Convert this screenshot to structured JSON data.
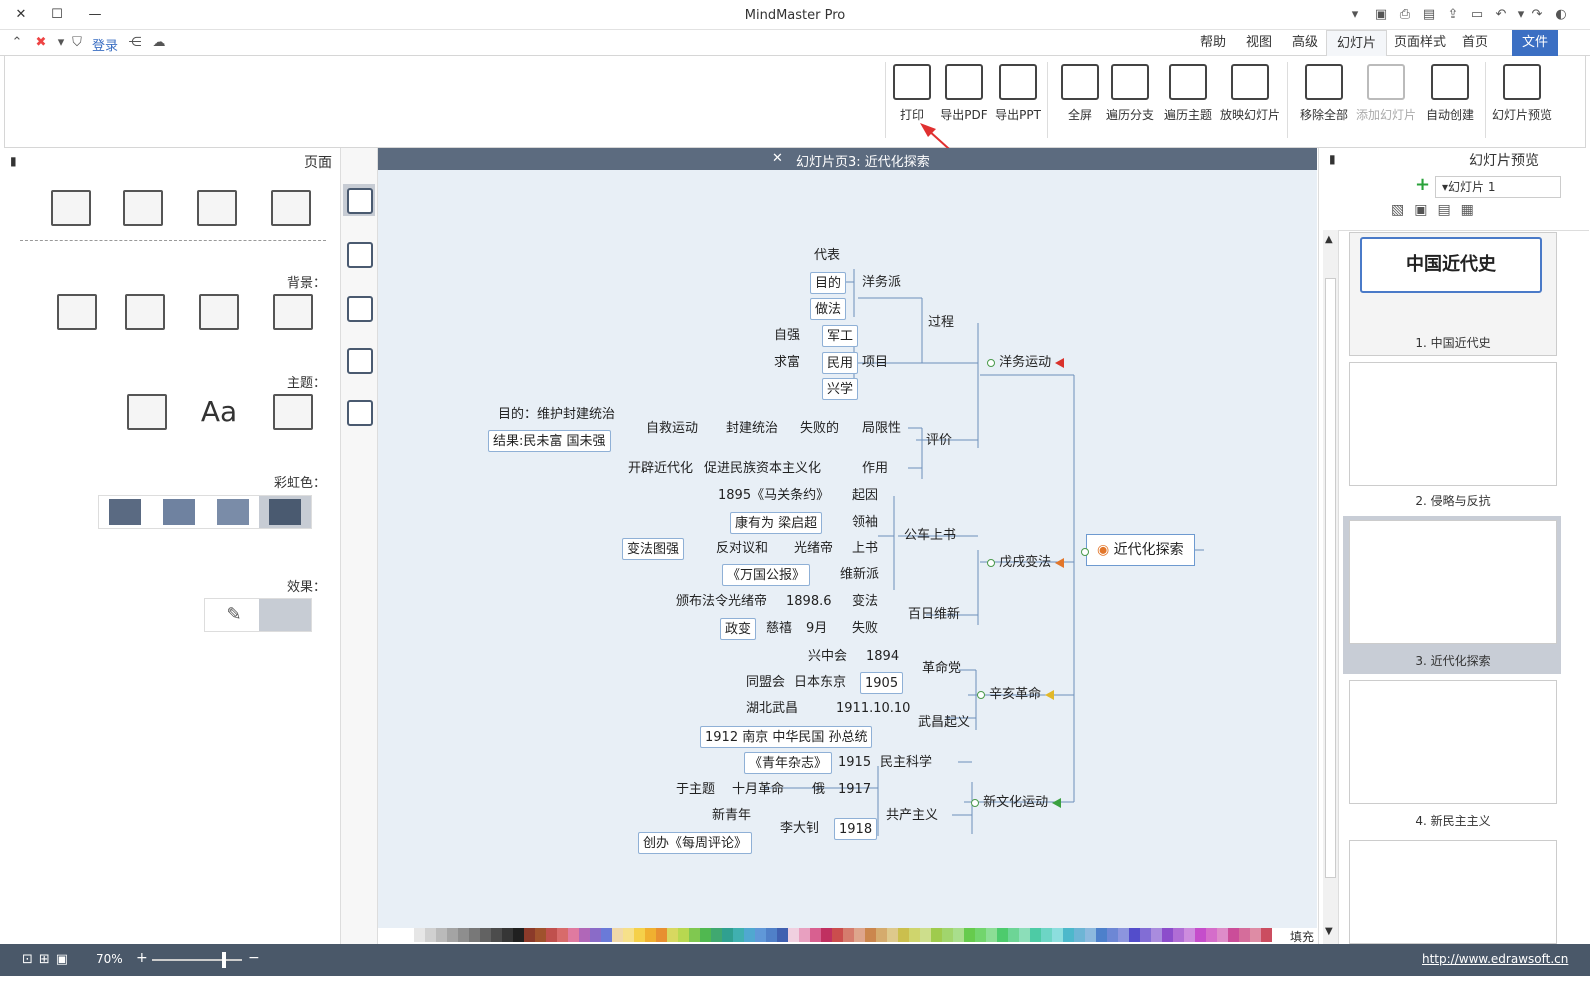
{
  "window": {
    "title": "MindMaster Pro"
  },
  "menu": {
    "file": "文件",
    "items": [
      "首页",
      "页面样式",
      "幻灯片",
      "高级",
      "视图",
      "帮助"
    ],
    "login": "登录"
  },
  "ribbon": {
    "buttons": [
      {
        "label": "幻灯片预览",
        "disabled": false
      },
      {
        "label": "自动创建",
        "disabled": false
      },
      {
        "label": "添加幻灯片",
        "disabled": true
      },
      {
        "label": "移除全部",
        "disabled": false
      },
      {
        "label": "放映幻灯片",
        "disabled": false
      },
      {
        "label": "遍历主题",
        "disabled": false
      },
      {
        "label": "遍历分支",
        "disabled": false
      },
      {
        "label": "全屏",
        "disabled": false
      },
      {
        "label": "导出PPT",
        "disabled": false
      },
      {
        "label": "导出PDF",
        "disabled": false
      },
      {
        "label": "打印",
        "disabled": false
      }
    ]
  },
  "left_pane": {
    "title": "页面",
    "sections": {
      "background": "背景：",
      "theme": "主题：",
      "rainbow": "彩虹色：",
      "effect": "效果："
    }
  },
  "canvas": {
    "header": "幻灯片页3: 近代化探索",
    "palette_label": "填充",
    "root": "近代化探索",
    "branches": [
      {
        "label": "洋务运动",
        "flag": "#d9312b"
      },
      {
        "label": "戊戌变法",
        "flag": "#e2762a"
      },
      {
        "label": "辛亥革命",
        "flag": "#e2b82a"
      },
      {
        "label": "新文化运动",
        "flag": "#3aa040"
      }
    ],
    "nodes": {
      "guocheng": "过程",
      "yangwupai": "洋务派",
      "daibiao": "代表",
      "mudi": "目的",
      "zuofa": "做法",
      "xiangmu": "项目",
      "jungong": "军工",
      "ziqiang": "自强",
      "minyong": "民用",
      "qiufu": "求富",
      "xingxue": "兴学",
      "pingjia": "评价",
      "juxianxing": "局限性",
      "shibaide": "失败的",
      "fengjian": "封建统治",
      "zijiu": "自救运动",
      "mudi2": "目的：维护封建统治",
      "jieguo": "结果:民未富 国未强",
      "zuoyong": "作用",
      "cujin": "促进民族资本主义化",
      "kaiqi": "开辟近代化",
      "gongche": "公车上书",
      "qiyin": "起因",
      "maguan": "1895《马关条约》",
      "lingxiu": "领袖",
      "kangliang": "康有为 梁启超",
      "shangshu": "上书",
      "guangxu": "光绪帝",
      "fandui": "反对议和",
      "bianfa": "变法图强",
      "weixinpai": "维新派",
      "wanguo": "《万国公报》",
      "bairi": "百日维新",
      "bianfa2": "变法",
      "date1898": "1898.6",
      "guangxu2": "光绪帝",
      "banbu": "颁布法令",
      "shibai": "失败",
      "jiuyue": "9月",
      "cixi": "慈禧",
      "zhengbian": "政变",
      "gemingdang": "革命党",
      "y1894": "1894",
      "xingzhonghui": "兴中会",
      "y1905": "1905",
      "tokyo": "日本东京",
      "tongmenghui": "同盟会",
      "wuchang": "武昌起义",
      "d19111010": "1911.10.10",
      "hubei": "湖北武昌",
      "y1912": "1912 南京 中华民国 孙总统",
      "minzhu": "民主科学",
      "y1915": "1915",
      "qingnian": "《青年杂志》",
      "gongchan": "共产主义",
      "y1917": "1917",
      "e": "俄",
      "shiyue": "十月革命",
      "yu": "于主题",
      "y1918": "1918",
      "lidazhao": "李大钊",
      "xinqingnian": "新青年",
      "chuangban": "创办《每周评论》"
    }
  },
  "right_pane": {
    "title": "幻灯片预览",
    "select_value": "幻灯片 1",
    "slides": [
      {
        "label": "1. 中国近代史",
        "thumb_title": "中国近代史"
      },
      {
        "label": "2. 侵略与反抗"
      },
      {
        "label": "3. 近代化探索"
      },
      {
        "label": "4. 新民主主义"
      }
    ]
  },
  "statusbar": {
    "url": "http://www.edrawsoft.cn",
    "zoom": "70%"
  },
  "colors": {
    "accent": "#3b6fc3",
    "canvas_bg": "#e8eff6",
    "header_bg": "#5c6b7f",
    "status_bg": "#4a5869",
    "arrow": "#e03030"
  }
}
